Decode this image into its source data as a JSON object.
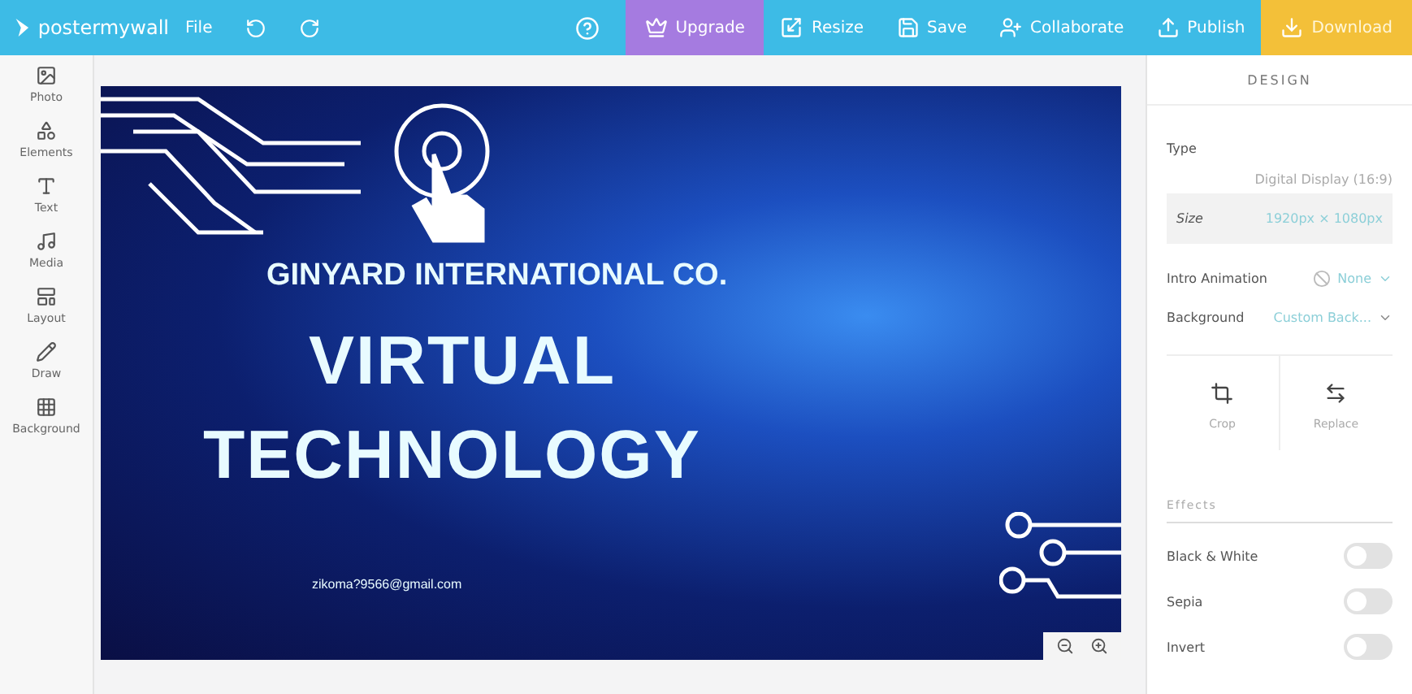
{
  "topbar": {
    "logo": "postermywall",
    "menu": "File",
    "actions": [
      {
        "kind": "upgrade",
        "label": "Upgrade"
      },
      {
        "kind": "resize",
        "label": "Resize"
      },
      {
        "kind": "save",
        "label": "Save"
      },
      {
        "kind": "collaborate",
        "label": "Collaborate"
      },
      {
        "kind": "publish",
        "label": "Publish"
      },
      {
        "kind": "download",
        "label": "Download"
      }
    ]
  },
  "sidebar": {
    "items": [
      {
        "kind": "photo",
        "label": "Photo"
      },
      {
        "kind": "elements",
        "label": "Elements"
      },
      {
        "kind": "text",
        "label": "Text"
      },
      {
        "kind": "media",
        "label": "Media"
      },
      {
        "kind": "layout",
        "label": "Layout"
      },
      {
        "kind": "draw",
        "label": "Draw"
      },
      {
        "kind": "background",
        "label": "Background"
      }
    ]
  },
  "poster": {
    "company": "GINYARD INTERNATIONAL CO.",
    "headline_1": "VIRTUAL",
    "headline_2": "TECHNOLOGY",
    "email": "zikoma?9566@gmail.com"
  },
  "panel": {
    "title": "DESIGN",
    "type_label": "Type",
    "type_value": "Digital Display (16:9)",
    "size_label": "Size",
    "size_value": "1920px × 1080px",
    "animation_label": "Intro Animation",
    "animation_value": "None",
    "background_label": "Background",
    "background_value": "Custom Back...",
    "tools": [
      {
        "kind": "crop",
        "label": "Crop"
      },
      {
        "kind": "replace",
        "label": "Replace"
      }
    ],
    "effects_title": "Effects",
    "effects": [
      {
        "label": "Black & White",
        "on": false
      },
      {
        "label": "Sepia",
        "on": false
      },
      {
        "label": "Invert",
        "on": false
      }
    ]
  }
}
